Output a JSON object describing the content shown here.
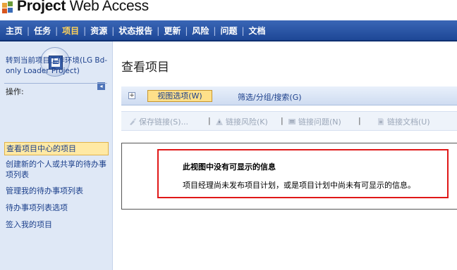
{
  "app": {
    "logo_text_bold": "Project",
    "logo_text_rest": " Web Access",
    "colors": {
      "nav_bg": "#2a55a6",
      "nav_active": "#ffd35a",
      "sidebar_bg": "#dfe8f6",
      "highlight_border": "#e01818"
    }
  },
  "nav": {
    "items": [
      "主页",
      "任务",
      "项目",
      "资源",
      "状态报告",
      "更新",
      "风险",
      "问题",
      "文档"
    ],
    "separator": "|"
  },
  "sidebar": {
    "icon": "project-center-icon",
    "env_link": "转到当前项目工作环境(LG Bd-only Loader Project)",
    "operations_label": "操作:",
    "links": [
      "查看项目中心的项目",
      "创建新的个人或共享的待办事项列表",
      "管理我的待办事项列表",
      "待办事项列表选项",
      "签入我的项目"
    ]
  },
  "main": {
    "title": "查看项目",
    "toolbar": {
      "expand": "+",
      "view_options": "视图选项(W)",
      "filter": "筛选/分组/搜索(G)"
    },
    "actions": {
      "save_link": "保存链接(S)...",
      "link_risk": "链接风险(K)",
      "link_issue": "链接问题(N)",
      "link_doc": "链接文档(U)"
    },
    "message": {
      "title": "此视图中没有可显示的信息",
      "body": "项目经理尚未发布项目计划，或是项目计划中尚未有可显示的信息。"
    }
  }
}
